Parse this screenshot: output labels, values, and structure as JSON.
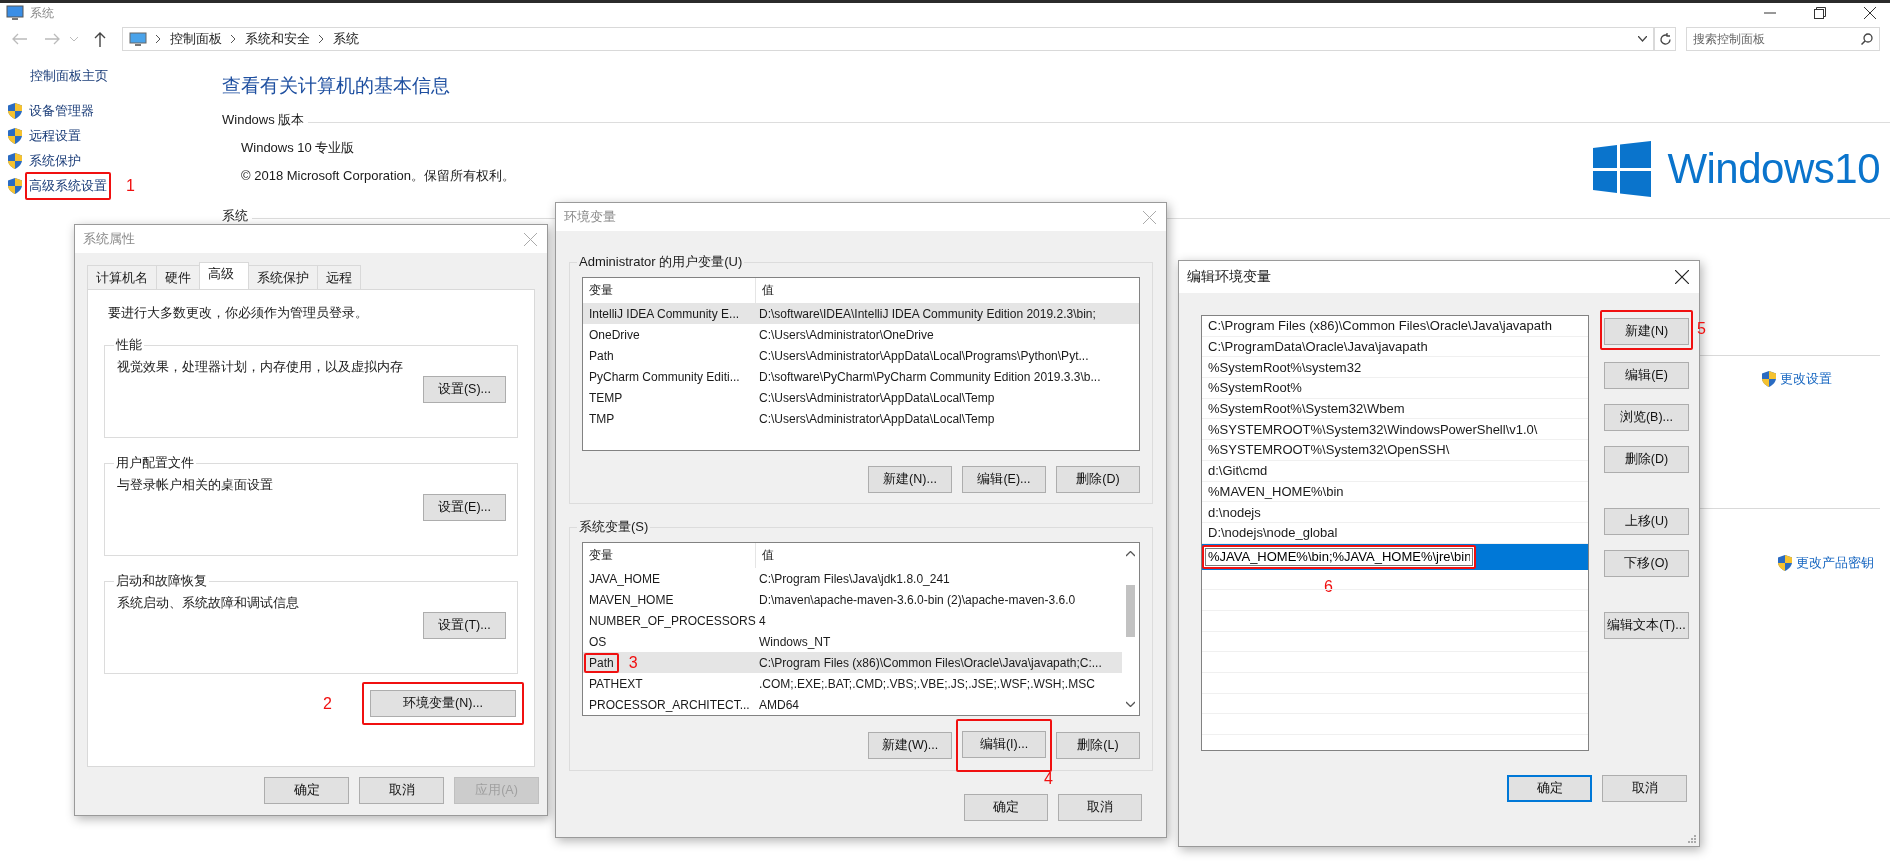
{
  "window": {
    "title": "系统"
  },
  "nav": {
    "breadcrumb": [
      "控制面板",
      "系统和安全",
      "系统"
    ],
    "search": {
      "placeholder": "搜索控制面板"
    }
  },
  "sidebar": {
    "home": "控制面板主页",
    "items": [
      {
        "label": "设备管理器"
      },
      {
        "label": "远程设置"
      },
      {
        "label": "系统保护"
      },
      {
        "label": "高级系统设置",
        "annotation": "1"
      }
    ]
  },
  "main": {
    "title": "查看有关计算机的基本信息",
    "sections": [
      {
        "heading": "Windows 版本",
        "lines": [
          "Windows 10 专业版",
          "© 2018 Microsoft Corporation。保留所有权利。"
        ]
      },
      {
        "heading": "系统"
      }
    ],
    "logo": {
      "text": "Windows10"
    },
    "links": [
      "更改设置",
      "更改产品密钥"
    ]
  },
  "system_properties": {
    "title": "系统属性",
    "tabs": [
      {
        "label": "计算机名",
        "selected": false
      },
      {
        "label": "硬件",
        "selected": false
      },
      {
        "label": "高级",
        "selected": true
      },
      {
        "label": "系统保护",
        "selected": false
      },
      {
        "label": "远程",
        "selected": false
      }
    ],
    "notice": "要进行大多数更改，你必须作为管理员登录。",
    "groups": [
      {
        "title": "性能",
        "text": "视觉效果，处理器计划，内存使用，以及虚拟内存",
        "button": "设置(S)..."
      },
      {
        "title": "用户配置文件",
        "text": "与登录帐户相关的桌面设置",
        "button": "设置(E)..."
      },
      {
        "title": "启动和故障恢复",
        "text": "系统启动、系统故障和调试信息",
        "button": "设置(T)..."
      }
    ],
    "env_button": {
      "label": "环境变量(N)...",
      "annotation": "2"
    },
    "buttons": [
      {
        "label": "确定",
        "disabled": false
      },
      {
        "label": "取消",
        "disabled": false
      },
      {
        "label": "应用(A)",
        "disabled": true
      }
    ]
  },
  "environment_variables": {
    "title": "环境变量",
    "user_vars": {
      "title": "Administrator 的用户变量(U)",
      "columns": [
        "变量",
        "值"
      ],
      "rows": [
        {
          "name": "IntelliJ IDEA Community E...",
          "value": "D:\\software\\IDEA\\IntelliJ IDEA Community Edition 2019.2.3\\bin;",
          "selected": true
        },
        {
          "name": "OneDrive",
          "value": "C:\\Users\\Administrator\\OneDrive",
          "selected": false
        },
        {
          "name": "Path",
          "value": "C:\\Users\\Administrator\\AppData\\Local\\Programs\\Python\\Pyt...",
          "selected": false
        },
        {
          "name": "PyCharm Community Editi...",
          "value": "D:\\software\\PyCharm\\PyCharm Community Edition 2019.3.3\\b...",
          "selected": false
        },
        {
          "name": "TEMP",
          "value": "C:\\Users\\Administrator\\AppData\\Local\\Temp",
          "selected": false
        },
        {
          "name": "TMP",
          "value": "C:\\Users\\Administrator\\AppData\\Local\\Temp",
          "selected": false
        }
      ],
      "buttons": [
        {
          "label": "新建(N)..."
        },
        {
          "label": "编辑(E)..."
        },
        {
          "label": "删除(D)"
        }
      ]
    },
    "system_vars": {
      "title": "系统变量(S)",
      "columns": [
        "变量",
        "值"
      ],
      "rows": [
        {
          "name": "JAVA_HOME",
          "value": "C:\\Program Files\\Java\\jdk1.8.0_241",
          "selected": false
        },
        {
          "name": "MAVEN_HOME",
          "value": "D:\\maven\\apache-maven-3.6.0-bin (2)\\apache-maven-3.6.0",
          "selected": false
        },
        {
          "name": "NUMBER_OF_PROCESSORS",
          "value": "4",
          "selected": false
        },
        {
          "name": "OS",
          "value": "Windows_NT",
          "selected": false
        },
        {
          "name": "Path",
          "value": "C:\\Program Files (x86)\\Common Files\\Oracle\\Java\\javapath;C:...",
          "selected": true,
          "annotation": "3"
        },
        {
          "name": "PATHEXT",
          "value": ".COM;.EXE;.BAT;.CMD;.VBS;.VBE;.JS;.JSE;.WSF;.WSH;.MSC",
          "selected": false
        },
        {
          "name": "PROCESSOR_ARCHITECT...",
          "value": "AMD64",
          "selected": false
        }
      ],
      "buttons": [
        {
          "label": "新建(W)..."
        },
        {
          "label": "编辑(I)...",
          "annotation": "4"
        },
        {
          "label": "删除(L)"
        }
      ]
    },
    "buttons": [
      {
        "label": "确定"
      },
      {
        "label": "取消"
      }
    ]
  },
  "edit_variable": {
    "title": "编辑环境变量",
    "entries": [
      {
        "kind": "item",
        "text": "C:\\Program Files (x86)\\Common Files\\Oracle\\Java\\javapath",
        "selected": false
      },
      {
        "kind": "item",
        "text": "C:\\ProgramData\\Oracle\\Java\\javapath",
        "selected": false
      },
      {
        "kind": "item",
        "text": "%SystemRoot%\\system32",
        "selected": false
      },
      {
        "kind": "item",
        "text": "%SystemRoot%",
        "selected": false
      },
      {
        "kind": "item",
        "text": "%SystemRoot%\\System32\\Wbem",
        "selected": false
      },
      {
        "kind": "item",
        "text": "%SYSTEMROOT%\\System32\\WindowsPowerShell\\v1.0\\",
        "selected": false
      },
      {
        "kind": "item",
        "text": "%SYSTEMROOT%\\System32\\OpenSSH\\",
        "selected": false
      },
      {
        "kind": "item",
        "text": "d:\\Git\\cmd",
        "selected": false
      },
      {
        "kind": "item",
        "text": "%MAVEN_HOME%\\bin",
        "selected": false
      },
      {
        "kind": "item",
        "text": "d:\\nodejs",
        "selected": false
      },
      {
        "kind": "item",
        "text": "D:\\nodejs\\node_global",
        "selected": false
      },
      {
        "kind": "input",
        "text": "%JAVA_HOME%\\bin;%JAVA_HOME%\\jre\\bin",
        "selected": true,
        "annotation": "6"
      }
    ],
    "side_buttons": [
      {
        "label": "新建(N)",
        "annotation": "5"
      },
      {
        "label": "编辑(E)"
      },
      {
        "label": "浏览(B)..."
      },
      {
        "label": "删除(D)"
      },
      {
        "label": "上移(U)"
      },
      {
        "label": "下移(O)"
      },
      {
        "label": "编辑文本(T)..."
      }
    ],
    "buttons": [
      {
        "label": "确定",
        "default": true
      },
      {
        "label": "取消",
        "default": false
      }
    ]
  }
}
